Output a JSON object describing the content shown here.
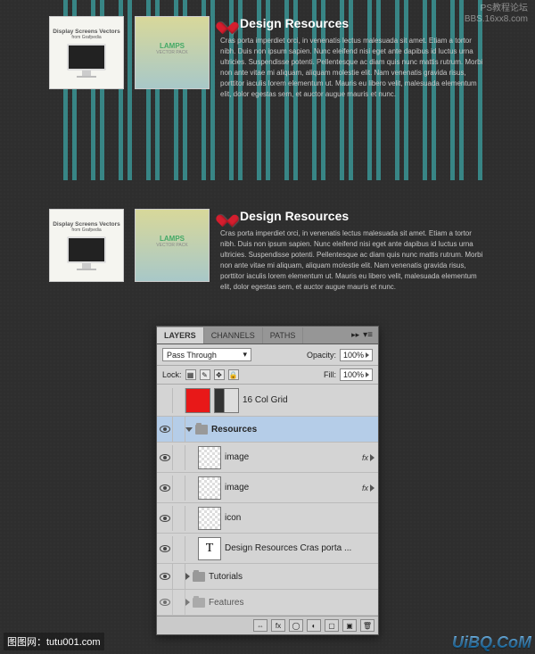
{
  "watermarks": {
    "top_right_line1": "PS教程论坛",
    "top_right_line2": "BBS.16xx8.com",
    "bottom_left": "图图网：tutu001.com",
    "bottom_right": "UiBQ.CoM"
  },
  "section1": {
    "thumb1_title": "Display Screens Vectors",
    "thumb1_sub": "from Grafpedia",
    "thumb2_title": "LAMPS",
    "thumb2_sub": "VECTOR PACK",
    "heading": "Design Resources",
    "body": "Cras porta imperdiet orci, in venenatis lectus malesuada sit amet. Etiam a tortor nibh. Duis non ipsum sapien. Nunc eleifend nisi eget ante dapibus id luctus urna ultricies. Suspendisse potenti. Pellentesque ac diam quis nunc mattis rutrum. Morbi non ante vitae mi aliquam, aliquam molestie elit. Nam venenatis gravida risus, porttitor iaculis lorem elementum ut. Mauris eu libero velit, malesuada elementum elit, dolor egestas sem, et auctor augue mauris et nunc."
  },
  "section2": {
    "thumb1_title": "Display Screens Vectors",
    "thumb1_sub": "from Grafpedia",
    "thumb2_title": "LAMPS",
    "thumb2_sub": "VECTOR PACK",
    "heading": "Design Resources",
    "body": "Cras porta imperdiet orci, in venenatis lectus malesuada sit amet. Etiam a tortor nibh. Duis non ipsum sapien. Nunc eleifend nisi eget ante dapibus id luctus urna ultricies. Suspendisse potenti. Pellentesque ac diam quis nunc mattis rutrum. Morbi non ante vitae mi aliquam, aliquam molestie elit. Nam venenatis gravida risus, porttitor iaculis lorem elementum ut. Mauris eu libero velit, malesuada elementum elit, dolor egestas sem, et auctor augue mauris et nunc."
  },
  "layers_panel": {
    "tabs": {
      "layers": "LAYERS",
      "channels": "CHANNELS",
      "paths": "PATHS"
    },
    "blend_mode": "Pass Through",
    "opacity_label": "Opacity:",
    "opacity_value": "100%",
    "lock_label": "Lock:",
    "fill_label": "Fill:",
    "fill_value": "100%",
    "layers": [
      {
        "name": "16 Col Grid"
      },
      {
        "name": "Resources"
      },
      {
        "name": "image"
      },
      {
        "name": "image"
      },
      {
        "name": "icon"
      },
      {
        "name": "Design Resources  Cras porta ..."
      },
      {
        "name": "Tutorials"
      },
      {
        "name": "Features"
      }
    ],
    "fx_label": "fx"
  }
}
